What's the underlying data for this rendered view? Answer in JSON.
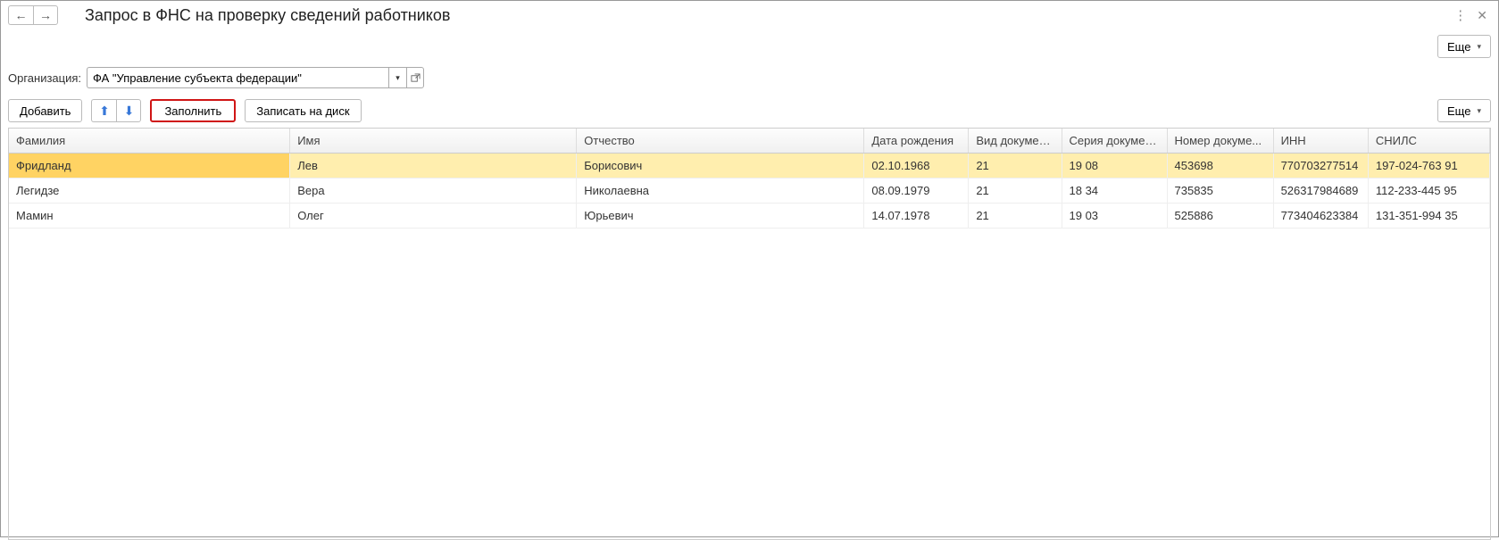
{
  "header": {
    "title": "Запрос в ФНС на проверку сведений работников",
    "more_label": "Еще"
  },
  "org": {
    "label": "Организация:",
    "value": "ФА \"Управление субъекта федерации\""
  },
  "toolbar": {
    "add_label": "Добавить",
    "fill_label": "Заполнить",
    "save_label": "Записать на диск",
    "more_label": "Еще"
  },
  "table": {
    "columns": {
      "lastname": "Фамилия",
      "firstname": "Имя",
      "middlename": "Отчество",
      "birthdate": "Дата рождения",
      "doctype": "Вид документа",
      "docseries": "Серия документа",
      "docnumber": "Номер докуме...",
      "inn": "ИНН",
      "snils": "СНИЛС"
    },
    "rows": [
      {
        "lastname": "Фридланд",
        "firstname": "Лев",
        "middlename": "Борисович",
        "birthdate": "02.10.1968",
        "doctype": "21",
        "docseries": "19 08",
        "docnumber": "453698",
        "inn": "770703277514",
        "snils": "197-024-763 91",
        "selected": true
      },
      {
        "lastname": "Легидзе",
        "firstname": "Вера",
        "middlename": "Николаевна",
        "birthdate": "08.09.1979",
        "doctype": "21",
        "docseries": "18 34",
        "docnumber": "735835",
        "inn": "526317984689",
        "snils": "112-233-445 95",
        "selected": false
      },
      {
        "lastname": "Мамин",
        "firstname": "Олег",
        "middlename": "Юрьевич",
        "birthdate": "14.07.1978",
        "doctype": "21",
        "docseries": "19 03",
        "docnumber": "525886",
        "inn": "773404623384",
        "snils": "131-351-994 35",
        "selected": false
      }
    ]
  }
}
